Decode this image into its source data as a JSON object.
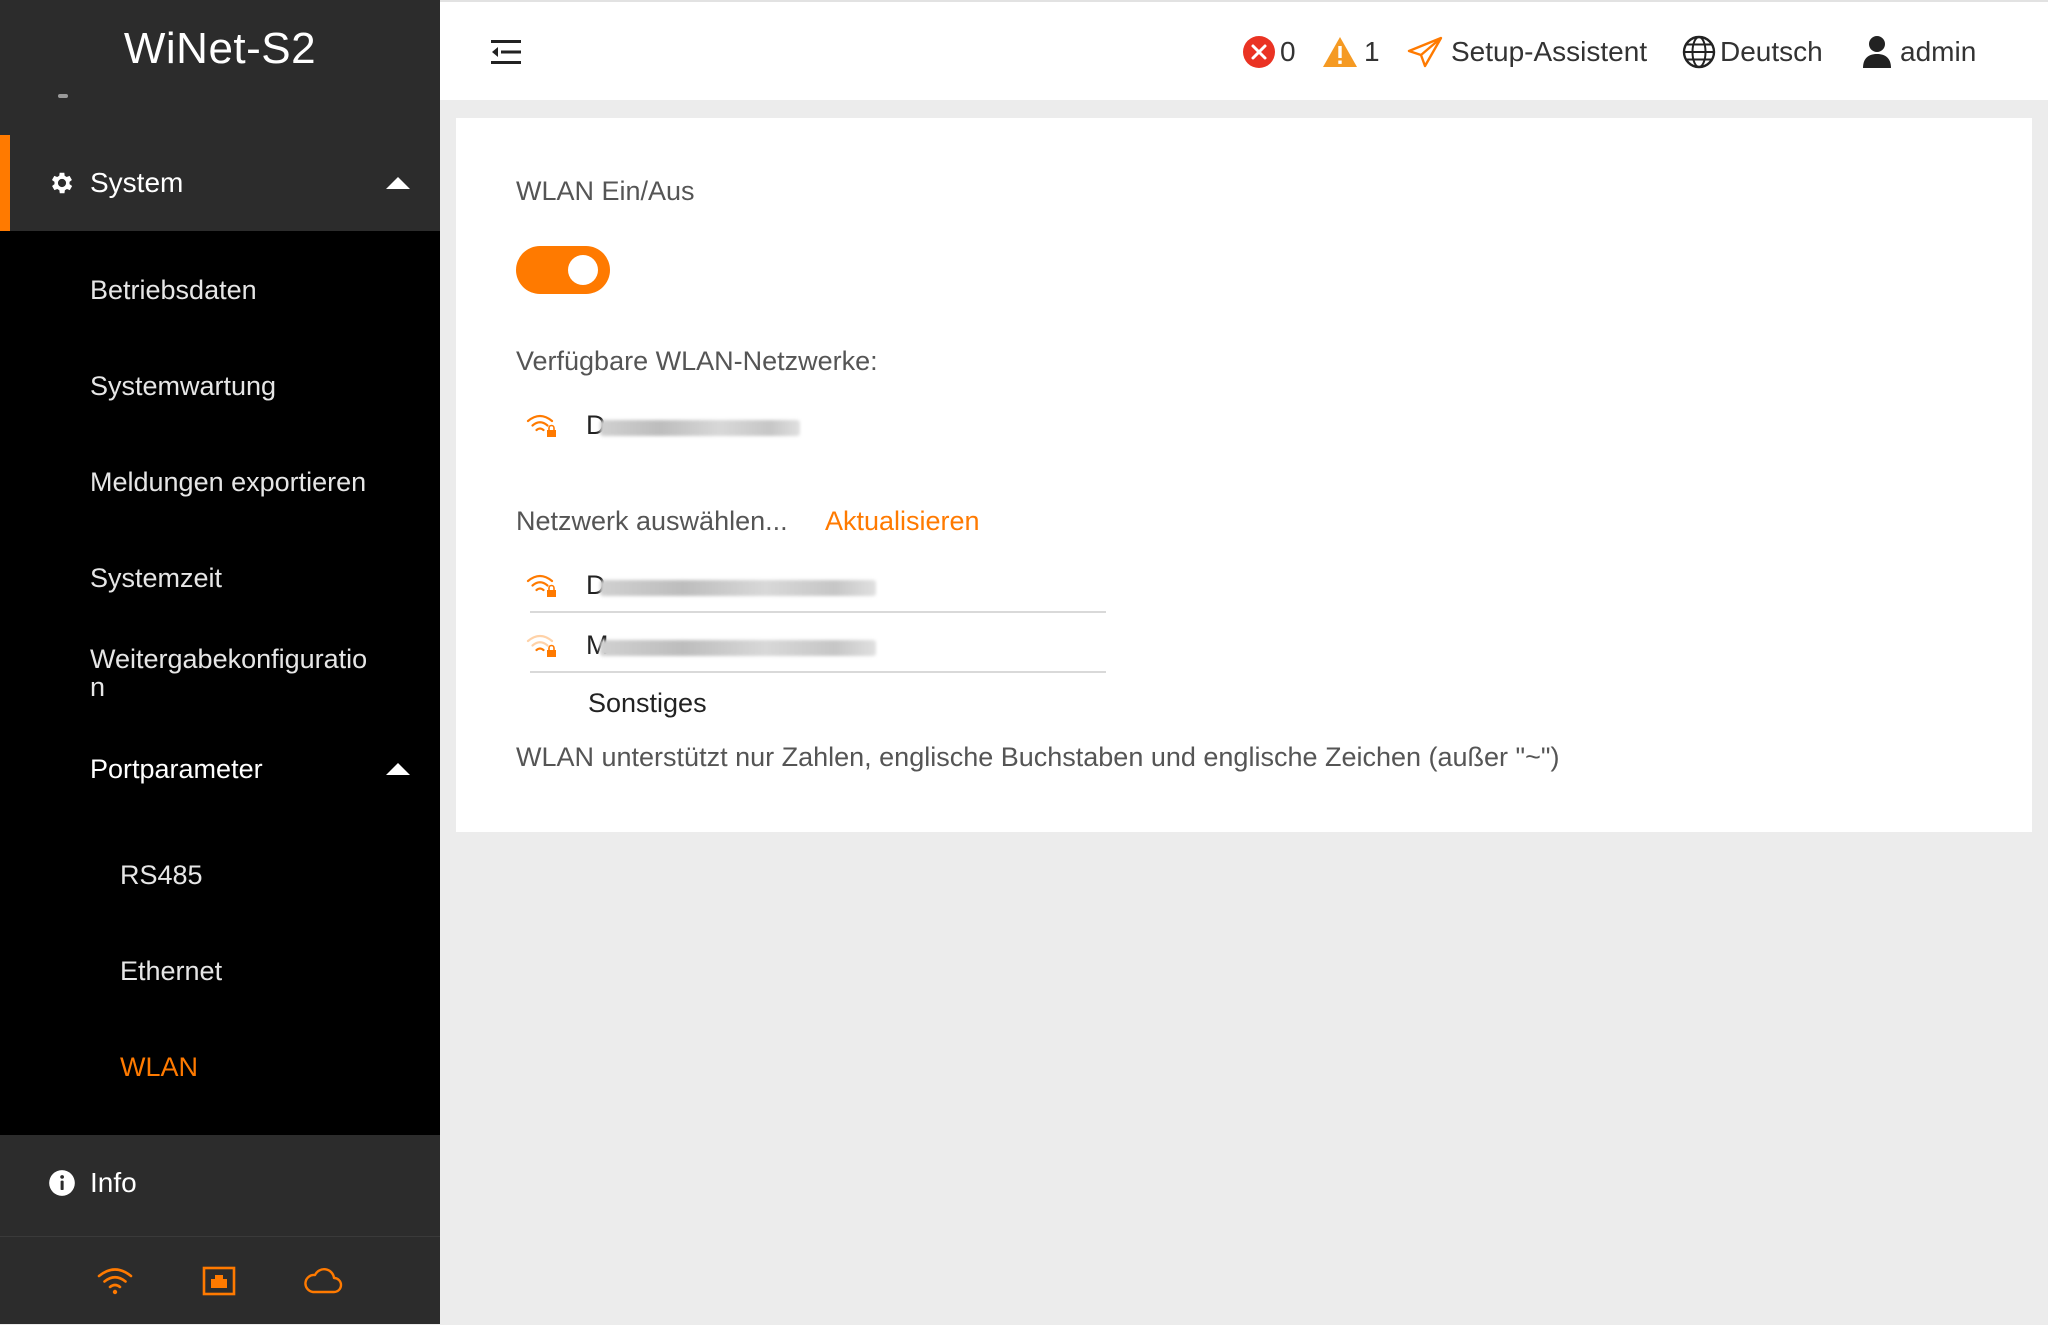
{
  "app": {
    "title": "WiNet-S2"
  },
  "colors": {
    "accent": "#ff7a00",
    "sidebar": "#2c2c2c",
    "submenu": "#000000"
  },
  "sidebar": {
    "system_label": "System",
    "items": [
      {
        "label": "Betriebsdaten"
      },
      {
        "label": "Systemwartung"
      },
      {
        "label": "Meldungen exportieren"
      },
      {
        "label": "Systemzeit"
      },
      {
        "label": "Weitergabekonfiguratio",
        "label_wrap": "n"
      },
      {
        "label": "Portparameter"
      }
    ],
    "port_items": [
      {
        "label": "RS485"
      },
      {
        "label": "Ethernet"
      },
      {
        "label": "WLAN"
      }
    ],
    "info_label": "Info",
    "footer_icons": [
      "wifi-icon",
      "ethernet-icon",
      "cloud-icon"
    ]
  },
  "header": {
    "error_count": "0",
    "warning_count": "1",
    "setup_label": "Setup-Assistent",
    "language_label": "Deutsch",
    "user_label": "admin"
  },
  "main": {
    "wlan_toggle_label": "WLAN Ein/Aus",
    "wlan_enabled": true,
    "available_label": "Verfügbare WLAN-Netzwerke:",
    "connected_network_initial": "D",
    "select_label": "Netzwerk auswählen...",
    "refresh_label": "Aktualisieren",
    "networks": [
      {
        "initial": "D",
        "signal": "strong"
      },
      {
        "initial": "M",
        "signal": "weak"
      }
    ],
    "other_label": "Sonstiges",
    "note": "WLAN unterstützt nur Zahlen, englische Buchstaben und englische Zeichen (außer \"~\")"
  }
}
